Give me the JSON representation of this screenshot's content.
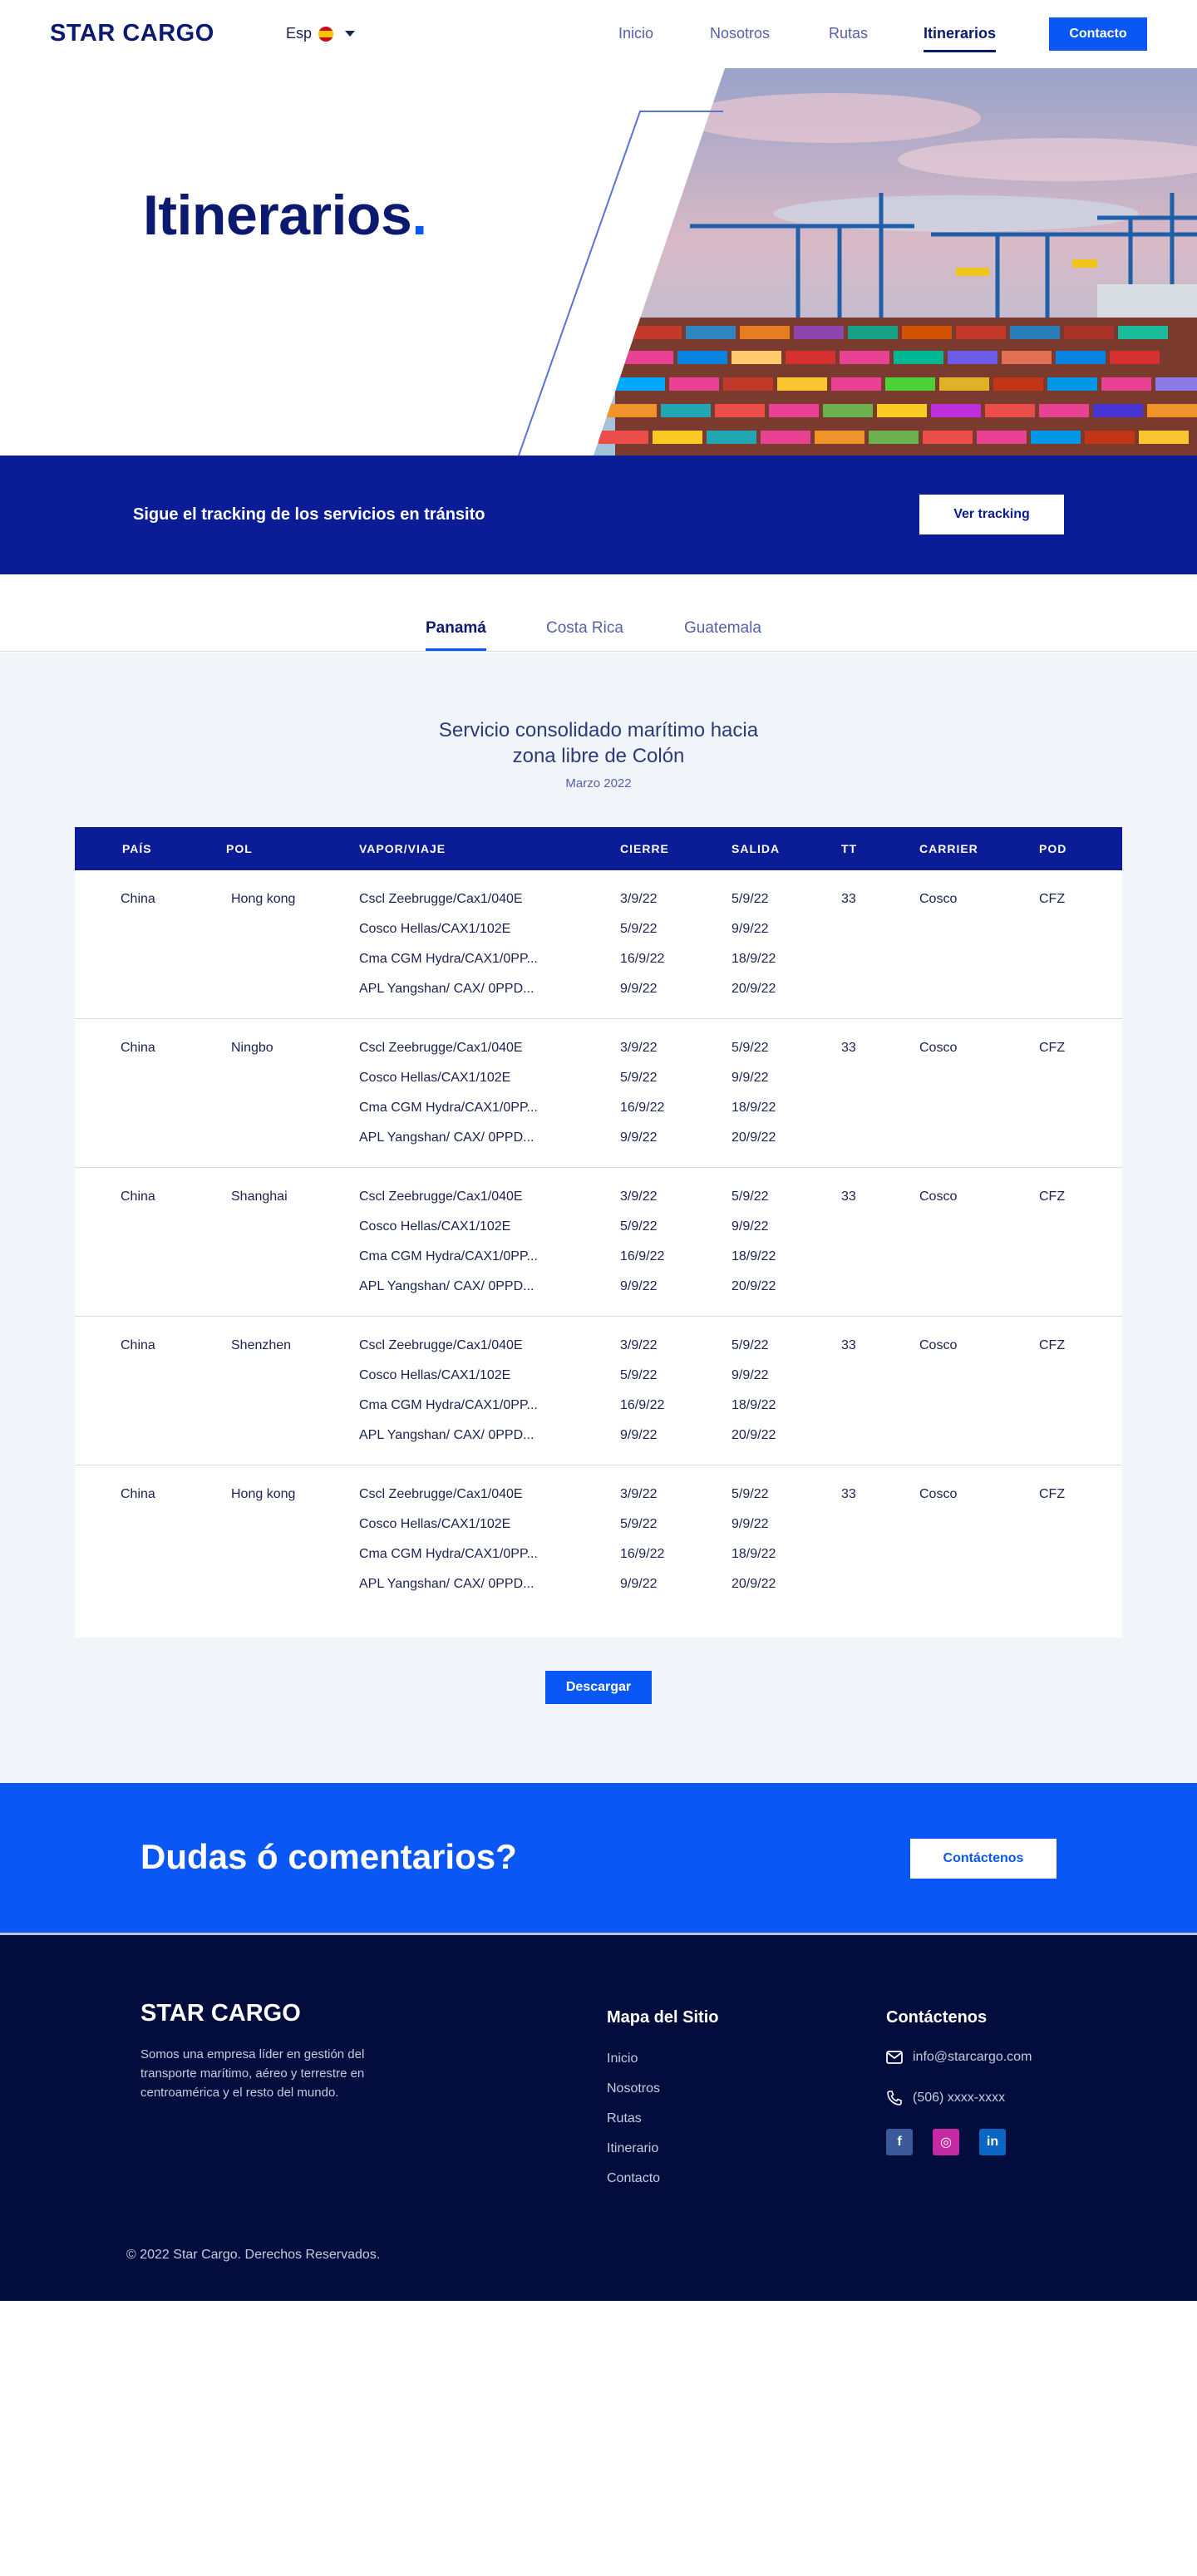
{
  "nav": {
    "logo": "STAR CARGO",
    "lang": "Esp",
    "links": [
      "Inicio",
      "Nosotros",
      "Rutas",
      "Itinerarios"
    ],
    "contact_btn": "Contacto"
  },
  "hero": {
    "title": "Itinerarios",
    "dot": "."
  },
  "tracking": {
    "text": "Sigue el tracking de los servicios en tránsito",
    "button": "Ver tracking"
  },
  "tabs": [
    "Panamá",
    "Costa Rica",
    "Guatemala"
  ],
  "section": {
    "title_line1": "Servicio consolidado marítimo hacia",
    "title_line2": "zona libre de Colón",
    "subtitle": "Marzo 2022"
  },
  "table": {
    "headers": [
      "PAÍS",
      "POL",
      "VAPOR/VIAJE",
      "CIERRE",
      "SALIDA",
      "TT",
      "CARRIER",
      "POD"
    ],
    "groups": [
      {
        "pais": "China",
        "pol": "Hong kong",
        "tt": "33",
        "carrier": "Cosco",
        "pod": "CFZ",
        "rows": [
          {
            "vapor": "Cscl Zeebrugge/Cax1/040E",
            "cierre": "3/9/22",
            "salida": "5/9/22"
          },
          {
            "vapor": "Cosco Hellas/CAX1/102E",
            "cierre": "5/9/22",
            "salida": "9/9/22"
          },
          {
            "vapor": "Cma CGM Hydra/CAX1/0PP...",
            "cierre": "16/9/22",
            "salida": "18/9/22"
          },
          {
            "vapor": "APL Yangshan/ CAX/ 0PPD...",
            "cierre": "9/9/22",
            "salida": "20/9/22"
          }
        ]
      },
      {
        "pais": "China",
        "pol": "Ningbo",
        "tt": "33",
        "carrier": "Cosco",
        "pod": "CFZ",
        "rows": [
          {
            "vapor": "Cscl Zeebrugge/Cax1/040E",
            "cierre": "3/9/22",
            "salida": "5/9/22"
          },
          {
            "vapor": "Cosco Hellas/CAX1/102E",
            "cierre": "5/9/22",
            "salida": "9/9/22"
          },
          {
            "vapor": "Cma CGM Hydra/CAX1/0PP...",
            "cierre": "16/9/22",
            "salida": "18/9/22"
          },
          {
            "vapor": "APL Yangshan/ CAX/ 0PPD...",
            "cierre": "9/9/22",
            "salida": "20/9/22"
          }
        ]
      },
      {
        "pais": "China",
        "pol": "Shanghai",
        "tt": "33",
        "carrier": "Cosco",
        "pod": "CFZ",
        "rows": [
          {
            "vapor": "Cscl Zeebrugge/Cax1/040E",
            "cierre": "3/9/22",
            "salida": "5/9/22"
          },
          {
            "vapor": "Cosco Hellas/CAX1/102E",
            "cierre": "5/9/22",
            "salida": "9/9/22"
          },
          {
            "vapor": "Cma CGM Hydra/CAX1/0PP...",
            "cierre": "16/9/22",
            "salida": "18/9/22"
          },
          {
            "vapor": "APL Yangshan/ CAX/ 0PPD...",
            "cierre": "9/9/22",
            "salida": "20/9/22"
          }
        ]
      },
      {
        "pais": "China",
        "pol": "Shenzhen",
        "tt": "33",
        "carrier": "Cosco",
        "pod": "CFZ",
        "rows": [
          {
            "vapor": "Cscl Zeebrugge/Cax1/040E",
            "cierre": "3/9/22",
            "salida": "5/9/22"
          },
          {
            "vapor": "Cosco Hellas/CAX1/102E",
            "cierre": "5/9/22",
            "salida": "9/9/22"
          },
          {
            "vapor": "Cma CGM Hydra/CAX1/0PP...",
            "cierre": "16/9/22",
            "salida": "18/9/22"
          },
          {
            "vapor": "APL Yangshan/ CAX/ 0PPD...",
            "cierre": "9/9/22",
            "salida": "20/9/22"
          }
        ]
      },
      {
        "pais": "China",
        "pol": "Hong kong",
        "tt": "33",
        "carrier": "Cosco",
        "pod": "CFZ",
        "rows": [
          {
            "vapor": "Cscl Zeebrugge/Cax1/040E",
            "cierre": "3/9/22",
            "salida": "5/9/22"
          },
          {
            "vapor": "Cosco Hellas/CAX1/102E",
            "cierre": "5/9/22",
            "salida": "9/9/22"
          },
          {
            "vapor": "Cma CGM Hydra/CAX1/0PP...",
            "cierre": "16/9/22",
            "salida": "18/9/22"
          },
          {
            "vapor": "APL Yangshan/ CAX/ 0PPD...",
            "cierre": "9/9/22",
            "salida": "20/9/22"
          }
        ]
      }
    ],
    "download_btn": "Descargar"
  },
  "cta": {
    "text": "Dudas ó comentarios?",
    "button": "Contáctenos"
  },
  "footer": {
    "logo": "STAR CARGO",
    "description": "Somos una empresa líder en gestión del transporte marítimo, aéreo y terrestre en centroamérica y el resto del mundo.",
    "sitemap_title": "Mapa del Sitio",
    "sitemap_links": [
      "Inicio",
      "Nosotros",
      "Rutas",
      "Itinerario",
      "Contacto"
    ],
    "contact_title": "Contáctenos",
    "email": "info@starcargo.com",
    "phone": "(506) xxxx-xxxx",
    "social": {
      "facebook": "f",
      "instagram": "◎",
      "linkedin": "in"
    },
    "copyright": "© 2022 Star Cargo. Derechos Reservados."
  },
  "colors": {
    "primary": "#0a57f5",
    "navy": "#0a1d96",
    "dark": "#020d3d"
  }
}
